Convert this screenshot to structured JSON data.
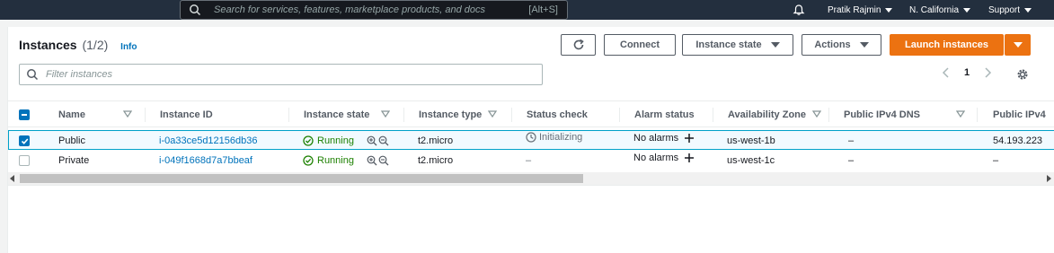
{
  "topbar": {
    "search_placeholder": "Search for services, features, marketplace products, and docs",
    "shortcut": "[Alt+S]",
    "user": "Pratik Rajmin",
    "region": "N. California",
    "support": "Support"
  },
  "panel": {
    "title": "Instances",
    "count": "(1/2)",
    "info": "Info",
    "buttons": {
      "connect": "Connect",
      "instance_state": "Instance state",
      "actions": "Actions",
      "launch": "Launch instances"
    },
    "filter_placeholder": "Filter instances",
    "page": "1"
  },
  "columns": [
    "Name",
    "Instance ID",
    "Instance state",
    "Instance type",
    "Status check",
    "Alarm status",
    "Availability Zone",
    "Public IPv4 DNS",
    "Public IPv4"
  ],
  "rows": [
    {
      "selected": true,
      "name": "Public",
      "id": "i-0a33ce5d12156db36",
      "state": "Running",
      "type": "t2.micro",
      "status": "Initializing",
      "alarm": "No alarms",
      "az": "us-west-1b",
      "dns": "–",
      "ip": "54.193.223"
    },
    {
      "selected": false,
      "name": "Private",
      "id": "i-049f1668d7a7bbeaf",
      "state": "Running",
      "type": "t2.micro",
      "status": "–",
      "alarm": "No alarms",
      "az": "us-west-1c",
      "dns": "–",
      "ip": "–"
    }
  ],
  "colors": {
    "accent": "#ec7211",
    "link": "#0073bb",
    "success": "#1d8102",
    "topbar": "#232f3e"
  }
}
